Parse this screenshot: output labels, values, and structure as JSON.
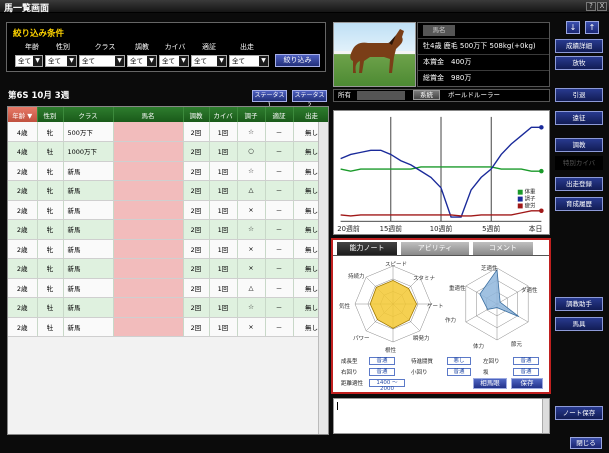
{
  "window": {
    "title": "馬一覧画面",
    "help": "?",
    "close": "X"
  },
  "filter": {
    "title": "絞り込み条件",
    "labels": [
      "年齢",
      "性別",
      "クラス",
      "調教",
      "カイバ",
      "適証",
      "出走"
    ],
    "values": [
      "全て",
      "全て",
      "全て",
      "全て",
      "全て",
      "全て",
      "全て"
    ],
    "apply_label": "絞り込み"
  },
  "week": "第6S 10月 3週",
  "status_buttons": [
    "ステータス1",
    "ステータス2"
  ],
  "table": {
    "headers": [
      "年齢 ▼",
      "性別",
      "クラス",
      "馬名",
      "調教",
      "カイバ",
      "調子",
      "適証",
      "出走"
    ],
    "rows": [
      [
        "4歳",
        "牝",
        "500万下",
        "",
        "2回",
        "1回",
        "☆",
        "－",
        "無し"
      ],
      [
        "4歳",
        "牡",
        "1000万下",
        "",
        "2回",
        "1回",
        "○",
        "－",
        "無し"
      ],
      [
        "2歳",
        "牝",
        "新馬",
        "",
        "2回",
        "1回",
        "☆",
        "－",
        "無し"
      ],
      [
        "2歳",
        "牝",
        "新馬",
        "",
        "2回",
        "1回",
        "△",
        "－",
        "無し"
      ],
      [
        "2歳",
        "牝",
        "新馬",
        "",
        "2回",
        "1回",
        "×",
        "－",
        "無し"
      ],
      [
        "2歳",
        "牝",
        "新馬",
        "",
        "2回",
        "1回",
        "☆",
        "－",
        "無し"
      ],
      [
        "2歳",
        "牝",
        "新馬",
        "",
        "2回",
        "1回",
        "×",
        "－",
        "無し"
      ],
      [
        "2歳",
        "牝",
        "新馬",
        "",
        "2回",
        "1回",
        "×",
        "－",
        "無し"
      ],
      [
        "2歳",
        "牝",
        "新馬",
        "",
        "2回",
        "1回",
        "△",
        "－",
        "無し"
      ],
      [
        "2歳",
        "牡",
        "新馬",
        "",
        "2回",
        "1回",
        "☆",
        "－",
        "無し"
      ],
      [
        "2歳",
        "牡",
        "新馬",
        "",
        "2回",
        "1回",
        "×",
        "－",
        "無し"
      ]
    ]
  },
  "horse": {
    "name_label": "馬名",
    "summary": "牡4歳 鹿毛 500万下 508kg(+0kg)",
    "prize_label": "本賞金",
    "prize": "400万",
    "total_label": "総賞金",
    "total": "980万",
    "owner_label": "所有",
    "lineage_label": "系統",
    "lineage": "ボールドルーラー"
  },
  "chart_data": {
    "type": "line",
    "x": [
      "20週前",
      "15週前",
      "10週前",
      "5週前",
      "本日"
    ],
    "series": [
      {
        "name": "体重",
        "color": "#1a9a2a",
        "values": [
          50,
          48,
          50,
          50,
          50,
          50,
          50,
          50,
          52,
          52,
          52,
          52,
          52,
          52,
          52,
          52,
          50,
          50,
          50,
          48,
          48
        ]
      },
      {
        "name": "調子",
        "color": "#1a2a9a",
        "values": [
          60,
          64,
          66,
          68,
          68,
          64,
          58,
          54,
          48,
          42,
          32,
          4,
          4,
          30,
          42,
          50,
          64,
          74,
          82,
          90,
          90
        ]
      },
      {
        "name": "疲労",
        "color": "#a01818",
        "values": [
          6,
          5,
          6,
          6,
          6,
          6,
          6,
          6,
          6,
          6,
          6,
          6,
          5,
          5,
          6,
          6,
          6,
          6,
          8,
          10,
          10
        ]
      }
    ],
    "ylim": [
      0,
      100
    ]
  },
  "ability": {
    "tabs": [
      "能力ノート",
      "アビリティ",
      "コメント"
    ],
    "radar1": {
      "labels": [
        "スピード",
        "スタミナ",
        "ゲート",
        "瞬発力",
        "根性",
        "パワー",
        "気性",
        "持続力"
      ],
      "values": [
        0.62,
        0.58,
        0.62,
        0.6,
        0.64,
        0.58,
        0.6,
        0.62
      ]
    },
    "radar2": {
      "labels": [
        "芝適性",
        "ダ適性",
        "重適性",
        "節元",
        "体力",
        "作力"
      ],
      "values": [
        0.95,
        0.1,
        0.7,
        0.1,
        0.3,
        0.55
      ]
    },
    "traits": {
      "growth_label": "成長型",
      "growth": "普通",
      "temper_label": "待進闘質",
      "temper": "悪し",
      "left_label": "左回り",
      "left": "普通",
      "right_label": "右回り",
      "right": "普通",
      "small_label": "小回り",
      "small": "普通",
      "slope_label": "坂",
      "slope": "普通",
      "distance_label": "距離適性",
      "distance": "1400 ～ 2000"
    },
    "sire_button": "相馬眼",
    "save_button": "保存"
  },
  "menu": [
    "成績詳細",
    "放牧",
    "引退",
    "遠征",
    "調教",
    "特別カイバ",
    "出走登録",
    "育成履歴",
    "調教助手",
    "馬具",
    "ノート保存"
  ],
  "close_label": "閉じる"
}
